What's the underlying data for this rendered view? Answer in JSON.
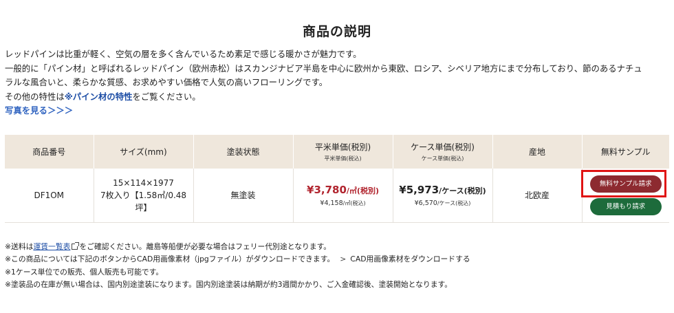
{
  "title": "商品の説明",
  "description": {
    "line1": "レッドパインは比重が軽く、空気の層を多く含んでいるため素足で感じる暖かさが魅力です。",
    "line2": "一般的に「パイン材」と呼ばれるレッドパイン（欧州赤松）はスカンジナビア半島を中心に欧州から東欧、ロシア、シベリア地方にまで分布しており、節のあるナチュ",
    "line3": "ラルな風合いと、柔らかな質感、お求めやすい価格で人気の高いフローリングです。",
    "line4_prefix": "その他の特性は",
    "line4_link": "※パイン材の特性",
    "line4_suffix": "をご覧ください。",
    "photo_link": "写真を見る＞＞＞"
  },
  "table": {
    "headers": {
      "code": "商品番号",
      "size": "サイズ(mm)",
      "finish": "塗装状態",
      "sqm_price": "平米単価(税別)",
      "sqm_price_sub": "平米単価(税込)",
      "case_price": "ケース単価(税別)",
      "case_price_sub": "ケース単価(税込)",
      "origin": "産地",
      "sample": "無料サンプル"
    },
    "row": {
      "code": "DF1OM",
      "size_line1": "15×114×1977",
      "size_line2": "7枚入り【1.58㎡/0.48",
      "size_line3": "坪】",
      "finish": "無塗装",
      "sqm_price_main": "¥3,780",
      "sqm_price_main_unit": "/㎡(税別)",
      "sqm_price_sub": "¥4,158",
      "sqm_price_sub_unit": "/㎡(税込)",
      "case_price_main": "¥5,973",
      "case_price_main_unit": "/ケース(税別)",
      "case_price_sub": "¥6,570",
      "case_price_sub_unit": "/ケース(税込)",
      "origin": "北欧産",
      "sample_button": "無料サンプル請求",
      "quote_button": "見積もり請求"
    }
  },
  "notes": {
    "line1_prefix": "※送料は",
    "line1_link": "運賃一覧表",
    "line1_suffix": "をご確認ください。離島等船便が必要な場合はフェリー代別途となります。",
    "line2": "※この商品については下記のボタンからCAD用画像素材（jpgファイル）がダウンロードできます。",
    "line2_link": "CAD用画像素材をダウンロードする",
    "line3": "※1ケース単位での販売、個人販売も可能です。",
    "line4": "※塗装品の在庫が無い場合は、国内別途塗装になります。国内別途塗装は納期が約3週間かかり、ご入金確認後、塗装開始となります。"
  },
  "colors": {
    "header_bg": "#efe7dc",
    "price_red": "#b1242e",
    "sample_button": "#8d2a30",
    "quote_button": "#1d6b3b",
    "highlight_border": "#e01414",
    "link_blue": "#1f4fa6"
  }
}
